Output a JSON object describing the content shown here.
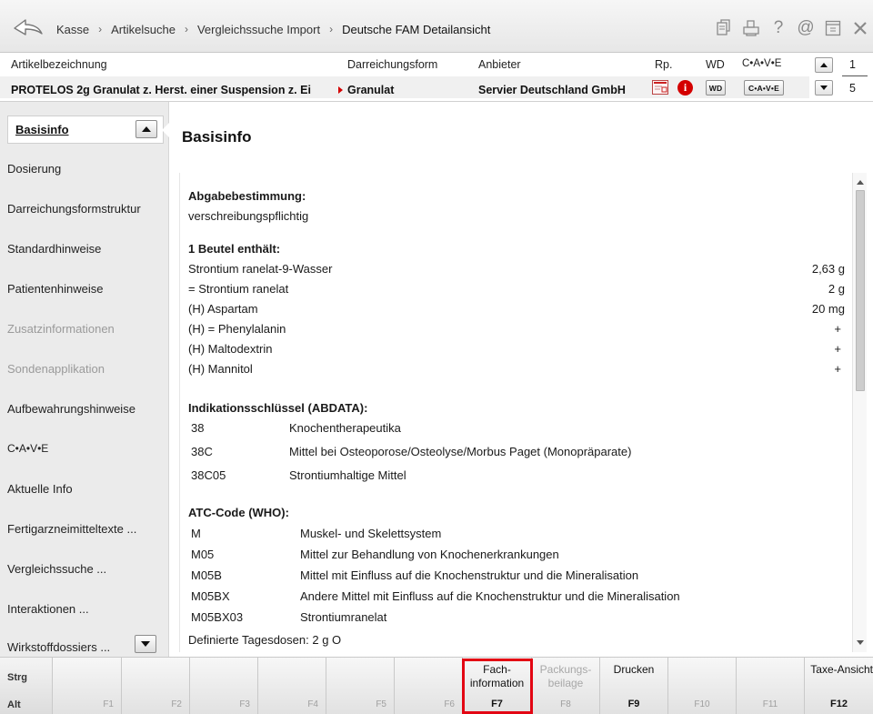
{
  "breadcrumbs": [
    "Kasse",
    "Artikelsuche",
    "Vergleichssuche Import",
    "Deutsche FAM Detailansicht"
  ],
  "title_icons": [
    "document-copy-icon",
    "print-icon",
    "help-icon",
    "at-icon",
    "window-icon",
    "close-icon"
  ],
  "header": {
    "col_article": "Artikelbezeichnung",
    "col_form": "Darreichungsform",
    "col_supplier": "Anbieter",
    "col_rp": "Rp.",
    "col_wd": "WD",
    "col_cave": "C•A•V•E",
    "article": "PROTELOS 2g Granulat z. Herst. einer Suspension z. Ei",
    "form": "Granulat",
    "supplier": "Servier Deutschland GmbH",
    "wd_badge": "WD",
    "cave_badge": "C•A•V•E",
    "page_current": "1",
    "page_total": "5"
  },
  "sidebar": {
    "active": "Basisinfo",
    "items": [
      {
        "label": "Dosierung",
        "disabled": false
      },
      {
        "label": "Darreichungsformstruktur",
        "disabled": false
      },
      {
        "label": "Standardhinweise",
        "disabled": false
      },
      {
        "label": "Patientenhinweise",
        "disabled": false
      },
      {
        "label": "Zusatzinformationen",
        "disabled": true
      },
      {
        "label": "Sondenapplikation",
        "disabled": true
      },
      {
        "label": "Aufbewahrungshinweise",
        "disabled": false
      },
      {
        "label": "C•A•V•E",
        "disabled": false
      },
      {
        "label": "Aktuelle Info",
        "disabled": false
      },
      {
        "label": "Fertigarzneimitteltexte ...",
        "disabled": false
      },
      {
        "label": "Vergleichssuche ...",
        "disabled": false
      },
      {
        "label": "Interaktionen ...",
        "disabled": false
      },
      {
        "label": "Wirkstoffdossiers ...",
        "disabled": false
      }
    ]
  },
  "main": {
    "title": "Basisinfo",
    "abgabe_heading": "Abgabebestimmung:",
    "abgabe_value": "verschreibungspflichtig",
    "beutel_heading": "1 Beutel enthält:",
    "ingredients": [
      {
        "name": "Strontium ranelat-9-Wasser",
        "amount": "2,63 g"
      },
      {
        "name": "= Strontium ranelat",
        "amount": "2 g"
      },
      {
        "name": "(H) Aspartam",
        "amount": "20 mg"
      },
      {
        "name": "(H) = Phenylalanin",
        "amount": "+"
      },
      {
        "name": "(H) Maltodextrin",
        "amount": "+"
      },
      {
        "name": "(H) Mannitol",
        "amount": "+"
      }
    ],
    "indikation_heading": "Indikationsschlüssel (ABDATA):",
    "indikation": [
      {
        "code": "38",
        "text": "Knochentherapeutika"
      },
      {
        "code": "38C",
        "text": "Mittel bei Osteoporose/Osteolyse/Morbus Paget (Monopräparate)"
      },
      {
        "code": "38C05",
        "text": "Strontiumhaltige Mittel"
      }
    ],
    "atc_heading": "ATC-Code (WHO):",
    "atc": [
      {
        "code": "M",
        "text": "Muskel- und Skelettsystem"
      },
      {
        "code": "M05",
        "text": "Mittel zur Behandlung von Knochenerkrankungen"
      },
      {
        "code": "M05B",
        "text": "Mittel mit Einfluss auf die Knochenstruktur und die Mineralisation"
      },
      {
        "code": "M05BX",
        "text": "Andere Mittel mit Einfluss auf die Knochenstruktur und die Mineralisation"
      },
      {
        "code": "M05BX03",
        "text": "Strontiumranelat"
      }
    ],
    "ddd": "Definierte Tagesdosen: 2 g O"
  },
  "fkeys": {
    "mod_strg": "Strg",
    "mod_alt": "Alt",
    "keys": [
      {
        "key": "F1",
        "label": "",
        "enabled": false
      },
      {
        "key": "F2",
        "label": "",
        "enabled": false
      },
      {
        "key": "F3",
        "label": "",
        "enabled": false
      },
      {
        "key": "F4",
        "label": "",
        "enabled": false
      },
      {
        "key": "F5",
        "label": "",
        "enabled": false
      },
      {
        "key": "F6",
        "label": "",
        "enabled": false
      },
      {
        "key": "F7",
        "label_1": "Fach-",
        "label_2": "information",
        "enabled": true
      },
      {
        "key": "F8",
        "label_1": "Packungs-",
        "label_2": "beilage",
        "enabled": false
      },
      {
        "key": "F9",
        "label": "Drucken",
        "enabled": true
      },
      {
        "key": "F10",
        "label": "",
        "enabled": false
      },
      {
        "key": "F11",
        "label": "",
        "enabled": false
      },
      {
        "key": "F12",
        "label": "Taxe-Ansicht",
        "enabled": true
      }
    ]
  },
  "colors": {
    "highlight": "#e30613",
    "info_icon": "#d40000"
  }
}
